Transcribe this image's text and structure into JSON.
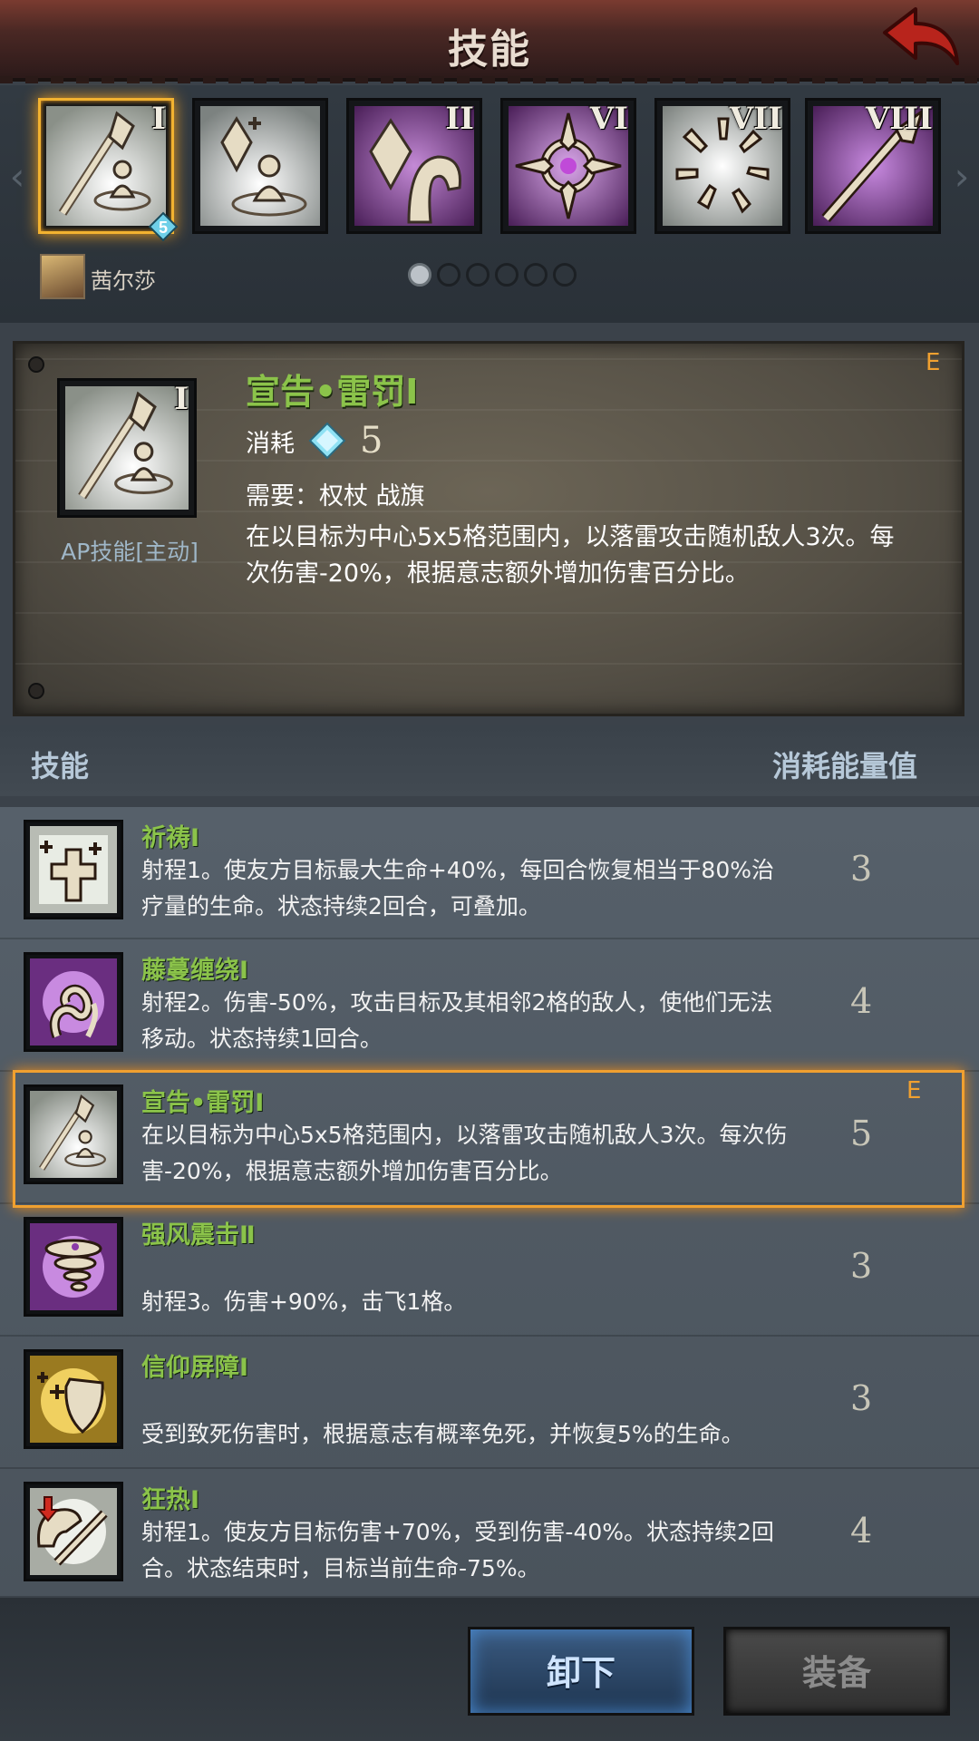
{
  "header": {
    "title": "技能"
  },
  "carousel": {
    "slots": [
      {
        "numeral": "I",
        "icon": "judgment-staff-icon",
        "selected": true,
        "badge": "5"
      },
      {
        "numeral": "",
        "icon": "crystal-blessing-icon",
        "selected": false
      },
      {
        "numeral": "II",
        "icon": "crystal-shield-icon",
        "selected": false
      },
      {
        "numeral": "VI",
        "icon": "holy-cross-burst-icon",
        "selected": false
      },
      {
        "numeral": "VII",
        "icon": "shatter-burst-icon",
        "selected": false
      },
      {
        "numeral": "VIII",
        "icon": "spear-icon",
        "selected": false
      }
    ],
    "character_name": "茜尔莎",
    "page_dots": 6,
    "active_dot": 0
  },
  "detail": {
    "numeral": "I",
    "grade": "E",
    "title": "宣告•雷罚Ⅰ",
    "ap_label": "AP技能[主动]",
    "cost_label": "消耗",
    "cost_value": "5",
    "requirement": "需要：权杖 战旗",
    "description": "在以目标为中心5x5格范围内，以落雷攻击随机敌人3次。每次伤害-20%，根据意志额外增加伤害百分比。"
  },
  "list_header": {
    "left": "技能",
    "right": "消耗能量值"
  },
  "skills": [
    {
      "name": "祈祷Ⅰ",
      "desc": "射程1。使友方目标最大生命+40%，每回合恢复相当于80%治疗量的生命。状态持续2回合，可叠加。",
      "cost": "3",
      "icon": "prayer-cross-icon",
      "selected": false,
      "grade": ""
    },
    {
      "name": "藤蔓缠绕Ⅰ",
      "desc": "射程2。伤害-50%，攻击目标及其相邻2格的敌人，使他们无法移动。状态持续1回合。",
      "cost": "4",
      "icon": "vine-entangle-icon",
      "selected": false,
      "grade": ""
    },
    {
      "name": "宣告•雷罚Ⅰ",
      "desc": "在以目标为中心5x5格范围内，以落雷攻击随机敌人3次。每次伤害-20%，根据意志额外增加伤害百分比。",
      "cost": "5",
      "icon": "judgment-staff-icon",
      "selected": true,
      "grade": "E"
    },
    {
      "name": "强风震击Ⅱ",
      "desc": "射程3。伤害+90%，击飞1格。",
      "cost": "3",
      "icon": "tornado-icon",
      "selected": false,
      "grade": ""
    },
    {
      "name": "信仰屏障Ⅰ",
      "desc": "受到致死伤害时，根据意志有概率免死，并恢复5%的生命。",
      "cost": "3",
      "icon": "faith-shield-icon",
      "selected": false,
      "grade": ""
    },
    {
      "name": "狂热Ⅰ",
      "desc": "射程1。使友方目标伤害+70%，受到伤害-40%。状态持续2回合。状态结束时，目标当前生命-75%。",
      "cost": "4",
      "icon": "zeal-sword-icon",
      "selected": false,
      "grade": ""
    }
  ],
  "buttons": {
    "unequip": "卸下",
    "equip": "装备"
  }
}
